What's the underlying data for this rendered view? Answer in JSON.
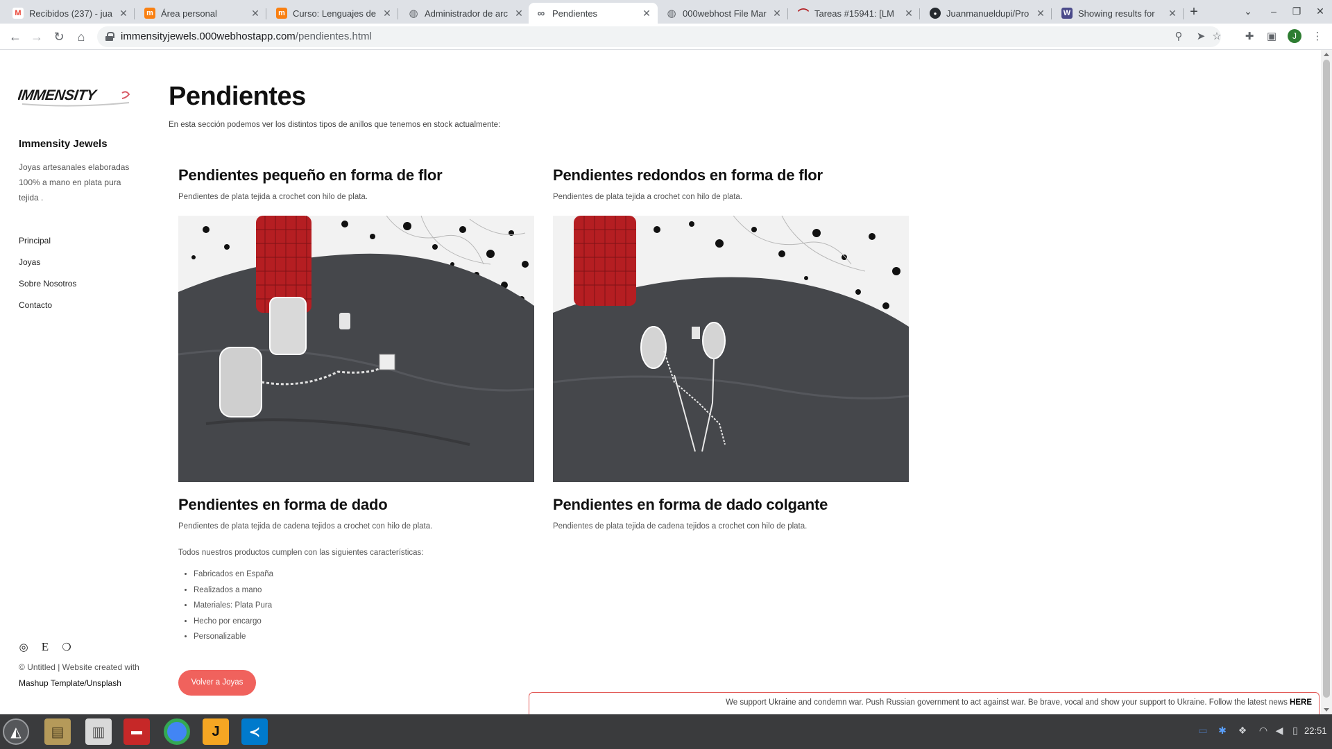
{
  "browser": {
    "tabs": [
      {
        "label": "Recibidos (237) - jua",
        "icon": "gmail-icon",
        "color": "#EA4335",
        "glyph": "M"
      },
      {
        "label": "Área personal",
        "icon": "moodle-icon",
        "color": "#F98012",
        "glyph": "m"
      },
      {
        "label": "Curso: Lenguajes de",
        "icon": "moodle-icon",
        "color": "#F98012",
        "glyph": "m"
      },
      {
        "label": "Administrador de arc",
        "icon": "globe-icon",
        "color": "#5f6368",
        "glyph": "◍"
      },
      {
        "label": "Pendientes",
        "icon": "earring-icon",
        "color": "#5f6368",
        "glyph": "∞",
        "active": true
      },
      {
        "label": "000webhost File Mar",
        "icon": "globe-icon",
        "color": "#5f6368",
        "glyph": "◍"
      },
      {
        "label": "Tareas #15941: [LM",
        "icon": "redmine-icon",
        "color": "#B32024",
        "glyph": "⌒"
      },
      {
        "label": "Juanmanueldupi/Pro",
        "icon": "github-icon",
        "color": "#24292e",
        "glyph": "●"
      },
      {
        "label": "Showing results for",
        "icon": "wolf-icon",
        "color": "#4a4a8a",
        "glyph": "W"
      }
    ],
    "url_host": "immensityjewels.000webhostapp.com",
    "url_path": "/pendientes.html",
    "profile_initial": "J"
  },
  "sidebar": {
    "logo_text": "IMMENSITY",
    "site_name": "Immensity Jewels",
    "tagline": "Joyas artesanales elaboradas 100% a mano en plata pura tejida .",
    "nav": [
      "Principal",
      "Joyas",
      "Sobre Nosotros",
      "Contacto"
    ],
    "social_icons": [
      "instagram-icon",
      "etsy-icon",
      "github-icon"
    ],
    "copyright_prefix": "© Untitled | Website created with",
    "copyright_link1": "Mashup Template",
    "copyright_sep": "/",
    "copyright_link2": "Unsplash"
  },
  "main": {
    "title": "Pendientes",
    "intro": "En esta sección podemos ver los distintos tipos de anillos que tenemos en stock actualmente:",
    "products": [
      {
        "title": "Pendientes pequeño en forma de flor",
        "desc": "Pendientes de plata tejida a crochet con hilo de plata."
      },
      {
        "title": "Pendientes redondos en forma de flor",
        "desc": "Pendientes de plata tejida a crochet con hilo de plata."
      },
      {
        "title": "Pendientes en forma de dado",
        "desc": "Pendientes de plata tejida de cadena tejidos a crochet con hilo de plata."
      },
      {
        "title": "Pendientes en forma de dado colgante",
        "desc": "Pendientes de plata tejida de cadena tejidos a crochet con hilo de plata."
      }
    ],
    "features_intro": "Todos nuestros productos cumplen con las siguientes características:",
    "features": [
      "Fabricados en España",
      "Realizados a mano",
      "Materiales: Plata Pura",
      "Hecho por encargo",
      "Personalizable"
    ],
    "back_button": "Volver a Joyas"
  },
  "banner": {
    "text": "We support Ukraine and condemn war. Push Russian government to act against war. Be brave, vocal and show your support to Ukraine. Follow the latest news",
    "link": "HERE"
  },
  "taskbar": {
    "clock": "22:51",
    "apps": [
      "zorin-menu-icon",
      "files-icon",
      "file-cabinet-icon",
      "terminal-icon",
      "chrome-icon",
      "intellij-icon",
      "vscode-icon"
    ]
  },
  "colors": {
    "accent": "#f0625d",
    "banner_border": "#e25b58"
  }
}
